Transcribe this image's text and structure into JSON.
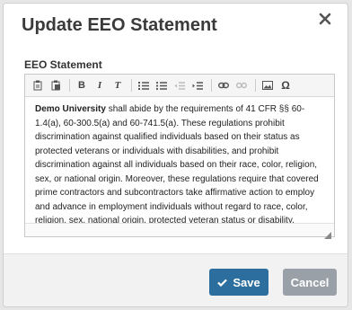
{
  "dialog": {
    "title": "Update EEO Statement"
  },
  "field": {
    "label": "EEO Statement"
  },
  "toolbar": {
    "icons": [
      "paste-text-icon",
      "paste-word-icon",
      "bold-icon",
      "italic-icon",
      "remove-format-icon",
      "numbered-list-icon",
      "bulleted-list-icon",
      "decrease-indent-icon",
      "increase-indent-icon",
      "link-icon",
      "unlink-icon",
      "image-icon",
      "special-character-icon"
    ],
    "bold": "B",
    "italic": "I",
    "clear": "T",
    "omega": "Ω"
  },
  "statement": {
    "org": "Demo University",
    "body": " shall abide by the requirements of 41 CFR §§ 60-1.4(a), 60-300.5(a) and 60-741.5(a). These regulations prohibit discrimination against qualified individuals based on their status as protected veterans or individuals with disabilities, and prohibit discrimination against all individuals based on their race, color, religion, sex, or national origin. Moreover, these regulations require that covered prime contractors and subcontractors take affirmative action to employ and advance in employment individuals without regard to race, color, religion, sex, national origin, protected veteran status or disability."
  },
  "buttons": {
    "save": "Save",
    "cancel": "Cancel"
  },
  "colors": {
    "save_bg": "#2c6f9f",
    "cancel_bg": "#9aa0a8"
  }
}
